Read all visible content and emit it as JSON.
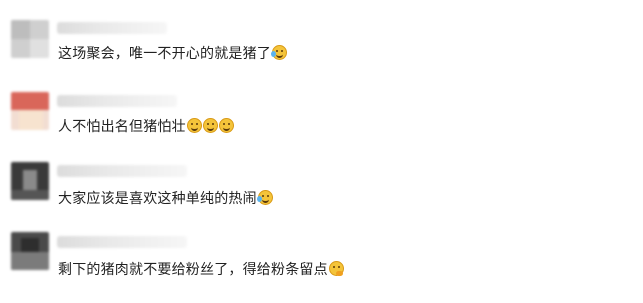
{
  "comments": [
    {
      "text": "这场聚会，唯一不开心的就是猪了",
      "emojis": [
        "laugh-cry-icon"
      ]
    },
    {
      "text": "人不怕出名但猪怕壮",
      "emojis": [
        "grin-icon",
        "grin-icon",
        "grin-icon"
      ]
    },
    {
      "text": "大家应该是喜欢这种单纯的热闹",
      "emojis": [
        "laugh-cry-icon"
      ]
    },
    {
      "text": "剩下的猪肉就不要给粉丝了，得给粉条留点",
      "emojis": [
        "thinking-icon"
      ]
    }
  ]
}
